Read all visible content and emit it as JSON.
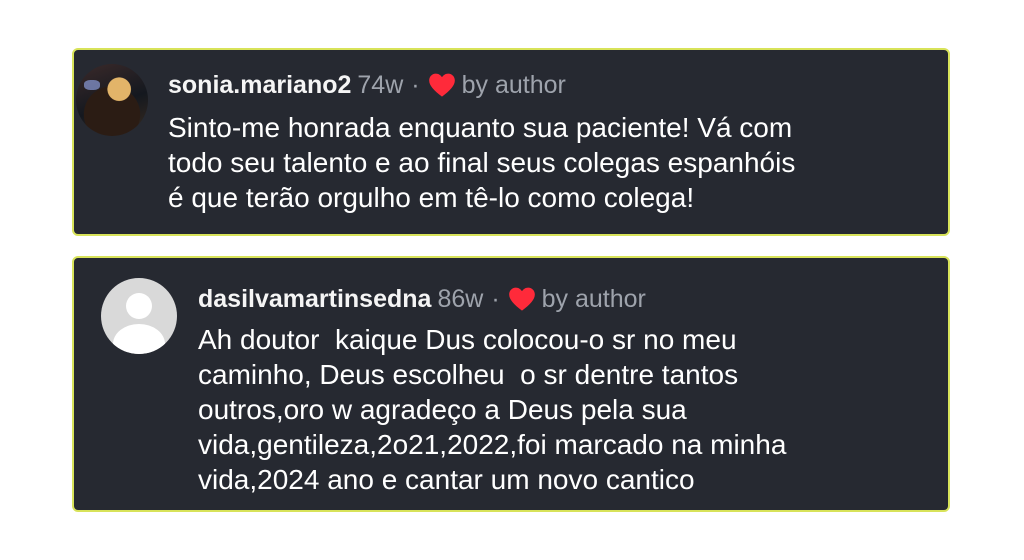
{
  "comments": [
    {
      "username": "sonia.mariano2",
      "age": "74w",
      "separator": "·",
      "liked_by": "by author",
      "avatar_icon": "user-photo",
      "heart_color": "#ff2a3a",
      "text_lines": [
        "Sinto-me honrada enquanto sua paciente! Vá com",
        "todo seu talento e ao final seus colegas espanhóis",
        "é que terão orgulho em tê-lo como colega!"
      ]
    },
    {
      "username": "dasilvamartinsedna",
      "age": "86w",
      "separator": "·",
      "liked_by": "by author",
      "avatar_icon": "default-user-avatar",
      "heart_color": "#ff2a3a",
      "text_lines": [
        "Ah doutor  kaique Dus colocou-o sr no meu",
        "caminho, Deus escolheu  o sr dentre tantos",
        "outros,oro w agradeço a Deus pela sua",
        "vida,gentileza,2o21,2022,foi marcado na minha",
        "vida,2024 ano e cantar um novo cantico"
      ]
    }
  ]
}
